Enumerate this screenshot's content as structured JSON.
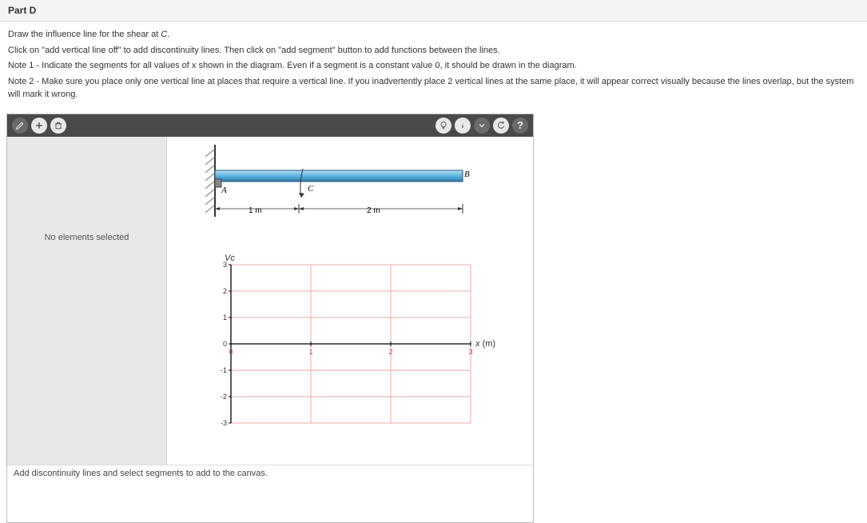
{
  "part_header": "Part D",
  "instructions": {
    "title_line": "Draw the influence line for the shear at C.",
    "line1": "Click on \"add vertical line off\" to add discontinuity lines. Then click on \"add segment\" button to add functions between the lines.",
    "line2": "Note 1 - Indicate the segments for all values of x shown in the diagram. Even if a segment is a constant value 0, it should be drawn in the diagram.",
    "line3": "Note 2 - Make sure you place only one vertical line at places that require a vertical line. If you inadvertently place 2 vertical lines at the same place, it will appear correct visually because the lines overlap, but the system will mark it wrong."
  },
  "toolbar": {
    "left": [
      "draw-tool",
      "add-tool",
      "delete-tool"
    ],
    "right": [
      "hint",
      "info",
      "chevron",
      "refresh",
      "help"
    ]
  },
  "left_panel_text": "No elements selected",
  "status_bar_text": "Add discontinuity lines and select segments to add to the canvas.",
  "beam": {
    "pointA": "A",
    "pointB": "B",
    "pointC": "C",
    "dim1": "1 m",
    "dim2": "2 m"
  },
  "chart_data": {
    "type": "line",
    "title": "",
    "ylabel": "Vc",
    "xlabel": "x (m)",
    "xlim": [
      0,
      3
    ],
    "ylim": [
      -3,
      3
    ],
    "x_ticks": [
      0,
      1,
      2,
      3
    ],
    "y_ticks": [
      -3,
      -2,
      -1,
      0,
      1,
      2,
      3
    ],
    "series": []
  }
}
